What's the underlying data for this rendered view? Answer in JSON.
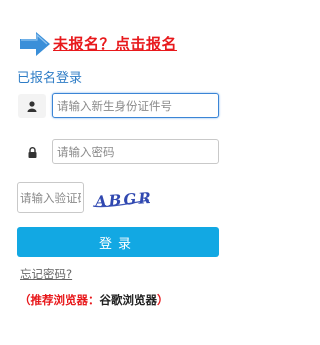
{
  "register_prompt": {
    "text": "未报名？点击报名",
    "color": "#e8191c",
    "icon": "arrow-right-icon"
  },
  "login": {
    "section_title": "已报名登录",
    "id_field": {
      "icon": "user-icon",
      "placeholder": "请输入新生身份证件号",
      "value": ""
    },
    "password_field": {
      "icon": "lock-icon",
      "placeholder": "请输入密码",
      "value": ""
    },
    "captcha_field": {
      "placeholder": "请输入验证码",
      "value": ""
    },
    "captcha_text": "ABGR",
    "login_button": "登录",
    "forgot_password": "忘记密码?"
  },
  "browser_tip": {
    "open_paren": "（",
    "label": "推荐浏览器：",
    "browser": "谷歌浏览器",
    "close_paren": "）"
  },
  "colors": {
    "accent_blue": "#12a8e3",
    "link_blue": "#2f7dc6",
    "warning_red": "#e8191c"
  }
}
